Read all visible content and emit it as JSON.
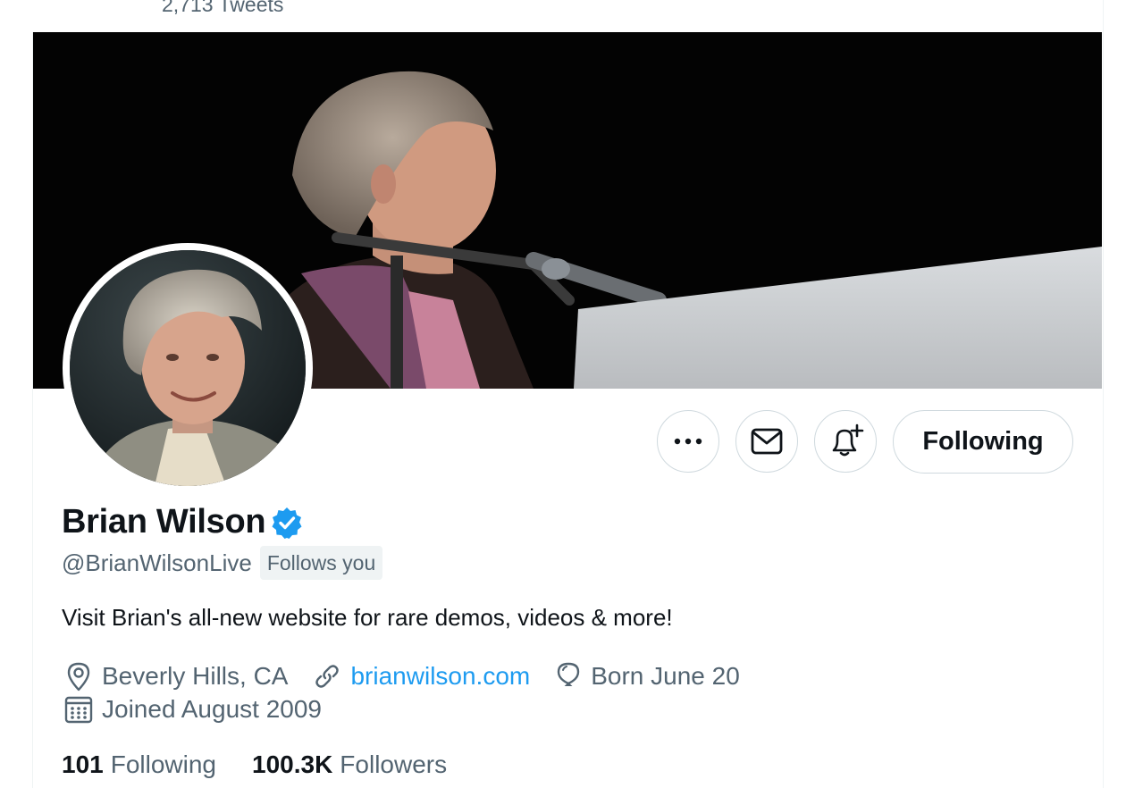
{
  "header": {
    "tweet_count": "2,713 Tweets"
  },
  "profile": {
    "name": "Brian Wilson",
    "handle": "@BrianWilsonLive",
    "follows_you": "Follows you",
    "bio": "Visit Brian's all-new website for rare demos, videos & more!",
    "location": "Beverly Hills, CA",
    "website": "brianwilson.com",
    "birthday": "Born June 20",
    "joined": "Joined August 2009",
    "following_count": "101",
    "following_label": "Following",
    "followers_count": "100.3K",
    "followers_label": "Followers"
  },
  "actions": {
    "more_icon": "more-horizontal-icon",
    "message_icon": "mail-icon",
    "notify_icon": "bell-plus-icon",
    "follow_state_label": "Following"
  },
  "colors": {
    "accent": "#1d9bf0",
    "secondary_text": "#536471",
    "primary_text": "#0f1419",
    "border": "#cfd9de"
  }
}
